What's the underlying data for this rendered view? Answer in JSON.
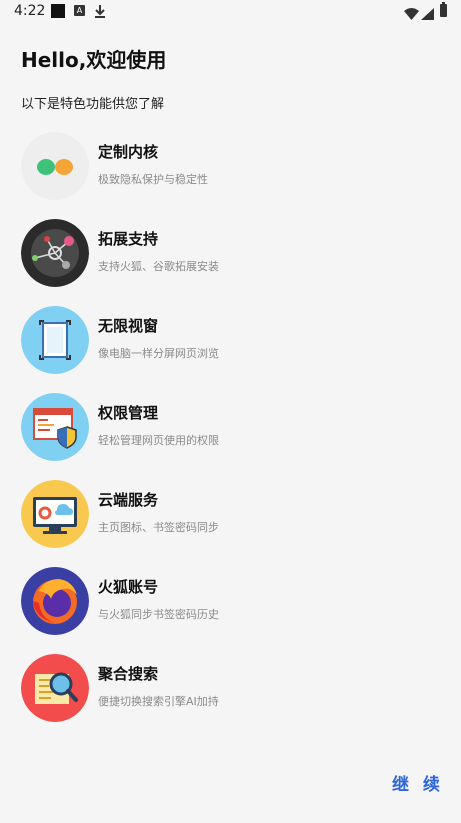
{
  "status_bar": {
    "time": "4:22",
    "icons": [
      "app-notification-icon",
      "a-badge-icon",
      "download-icon",
      "wifi-icon",
      "signal-icon",
      "battery-icon"
    ]
  },
  "header": {
    "title": "Hello,欢迎使用",
    "subtitle": "以下是特色功能供您了解"
  },
  "features": [
    {
      "name": "定制内核",
      "desc": "极致隐私保护与稳定性",
      "icon": "custom-kernel-icon",
      "color": "#eeeeee"
    },
    {
      "name": "拓展支持",
      "desc": "支持火狐、谷歌拓展安装",
      "icon": "extension-icon",
      "color": "#2b2b2b"
    },
    {
      "name": "无限视窗",
      "desc": "像电脑一样分屏网页浏览",
      "icon": "window-icon",
      "color": "#7fd0f3"
    },
    {
      "name": "权限管理",
      "desc": "轻松管理网页使用的权限",
      "icon": "permission-icon",
      "color": "#7fd0f3"
    },
    {
      "name": "云端服务",
      "desc": "主页图标、书签密码同步",
      "icon": "cloud-service-icon",
      "color": "#f9c94f"
    },
    {
      "name": "火狐账号",
      "desc": "与火狐同步书签密码历史",
      "icon": "firefox-icon",
      "color": "#3a3fa4"
    },
    {
      "name": "聚合搜索",
      "desc": "便捷切换搜索引擎AI加持",
      "icon": "search-aggregate-icon",
      "color": "#f24c4c"
    }
  ],
  "footer": {
    "continue_label": "继 续",
    "accent": "#2f67d8"
  }
}
